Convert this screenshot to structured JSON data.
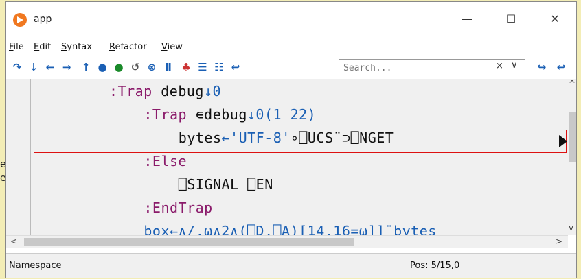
{
  "window": {
    "title": "app"
  },
  "background_fragments": [
    "e",
    "e("
  ],
  "menu": [
    {
      "label": "File",
      "u": "F",
      "rest": "ile"
    },
    {
      "label": "Edit",
      "u": "E",
      "rest": "dit"
    },
    {
      "label": "Syntax",
      "u": "S",
      "rest": "yntax"
    },
    {
      "label": "Refactor",
      "u": "R",
      "rest": "efactor"
    },
    {
      "label": "View",
      "u": "V",
      "rest": "iew"
    }
  ],
  "toolbar": {
    "search_placeholder": "Search...",
    "search_clear": "×",
    "search_dropdown": "∨"
  },
  "code_lines": [
    {
      "indent": 4,
      "parts": [
        {
          "t": ":Trap ",
          "c": "kw"
        },
        {
          "t": "debug",
          "c": "name"
        },
        {
          "t": "↓0",
          "c": "num"
        }
      ]
    },
    {
      "indent": 8,
      "parts": [
        {
          "t": ":Trap ",
          "c": "kw"
        },
        {
          "t": "∊debug",
          "c": "name"
        },
        {
          "t": "↓0(1 22)",
          "c": "num"
        }
      ]
    },
    {
      "indent": 12,
      "parts": [
        {
          "t": "bytes",
          "c": "name"
        },
        {
          "t": "←'UTF-8'",
          "c": "str"
        },
        {
          "t": "∘⎕UCS¨⊃⎕NGET",
          "c": "name"
        }
      ]
    },
    {
      "indent": 8,
      "parts": [
        {
          "t": ":Else",
          "c": "kw"
        }
      ]
    },
    {
      "indent": 12,
      "parts": [
        {
          "t": "⎕SIGNAL ⎕EN",
          "c": "name"
        }
      ]
    },
    {
      "indent": 8,
      "parts": [
        {
          "t": ":EndTrap",
          "c": "kw"
        }
      ]
    },
    {
      "indent": 8,
      "parts": [
        {
          "t": "box←∧/,⍵∧2∧(⎕D,⎕A)[14,16=⍵]]¨bytes",
          "c": "fn"
        }
      ]
    }
  ],
  "colors": {
    "keyword": "#8a1a6a",
    "number": "#1a5fb4",
    "highlight_border": "#d11"
  },
  "status": {
    "left": "Namespace",
    "right": "Pos: 5/15,0"
  }
}
